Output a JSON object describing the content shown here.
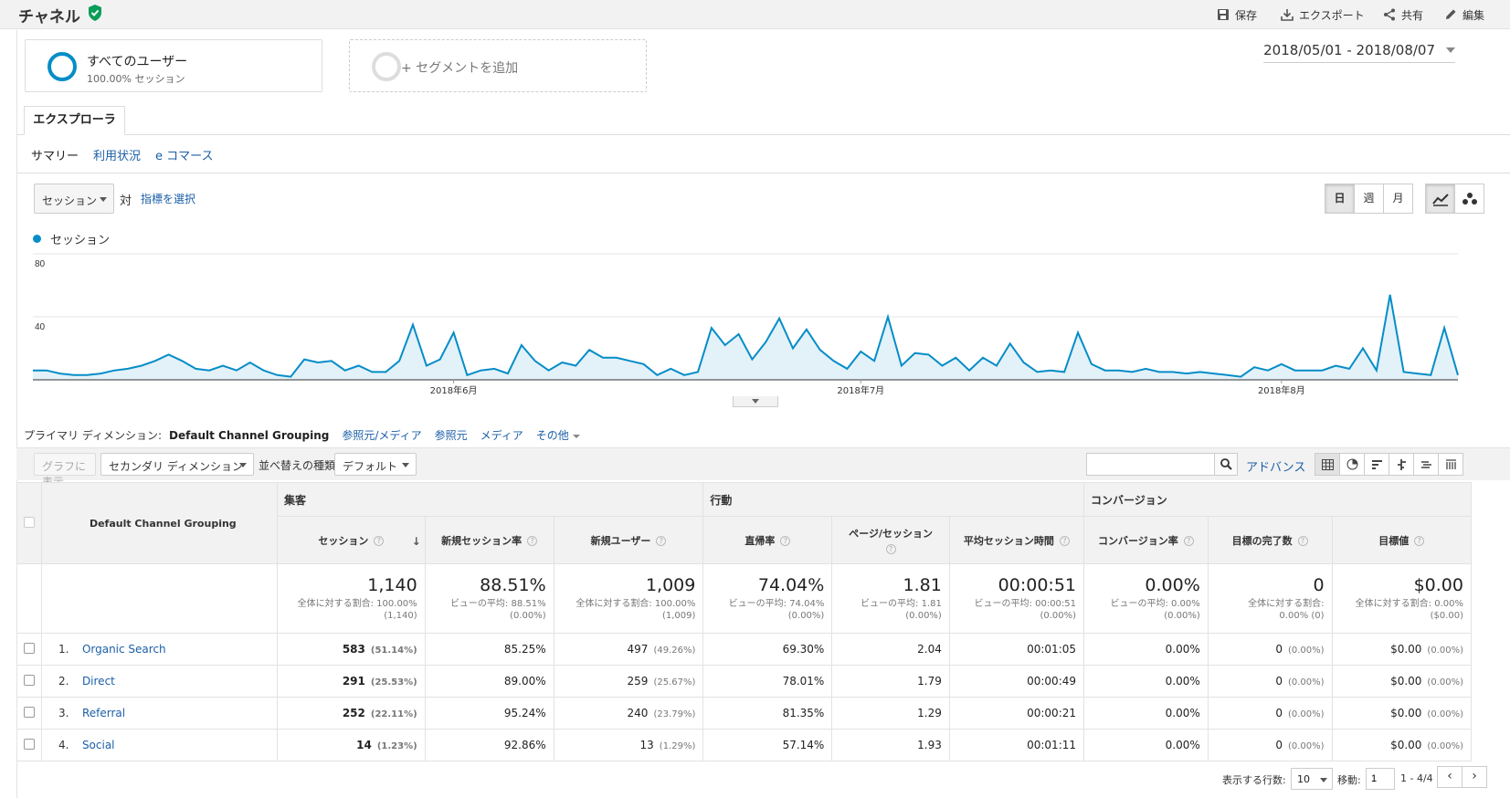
{
  "header": {
    "title": "チャネル",
    "actions": [
      {
        "label": "保存",
        "icon": "save-icon"
      },
      {
        "label": "エクスポート",
        "icon": "export-icon"
      },
      {
        "label": "共有",
        "icon": "share-icon"
      },
      {
        "label": "編集",
        "icon": "edit-icon"
      }
    ]
  },
  "segments": {
    "all": {
      "name": "すべてのユーザー",
      "sub": "100.00% セッション"
    },
    "add": {
      "name": "+ セグメントを追加"
    }
  },
  "date_range": "2018/05/01 - 2018/08/07",
  "tabs": {
    "explorer": "エクスプローラ"
  },
  "subtabs": [
    "サマリー",
    "利用状況",
    "e コマース"
  ],
  "chart_controls": {
    "metric": "セッション",
    "vs": "対",
    "choose_metric": "指標を選択",
    "periods": [
      "日",
      "週",
      "月"
    ],
    "active_period": "日"
  },
  "chart_data": {
    "type": "area",
    "series": [
      {
        "name": "セッション",
        "color": "#058dc7",
        "values": [
          6,
          6,
          4,
          3,
          3,
          4,
          6,
          7,
          9,
          12,
          16,
          12,
          7,
          6,
          9,
          6,
          11,
          6,
          3,
          2,
          13,
          11,
          12,
          6,
          9,
          5,
          5,
          12,
          35,
          9,
          13,
          30,
          3,
          6,
          7,
          4,
          22,
          12,
          6,
          11,
          9,
          19,
          14,
          14,
          12,
          10,
          3,
          7,
          3,
          5,
          33,
          22,
          29,
          13,
          24,
          39,
          20,
          32,
          19,
          12,
          7,
          18,
          12,
          40,
          9,
          17,
          16,
          9,
          14,
          6,
          14,
          9,
          23,
          11,
          5,
          6,
          5,
          30,
          10,
          6,
          6,
          5,
          7,
          5,
          5,
          4,
          5,
          4,
          3,
          2,
          8,
          6,
          10,
          6,
          6,
          6,
          9,
          7,
          20,
          6,
          54,
          5,
          4,
          3,
          33,
          3
        ]
      }
    ],
    "x_labels": [
      "2018年6月",
      "2018年7月",
      "2018年8月"
    ],
    "y_ticks": [
      40,
      80
    ],
    "ylim": [
      0,
      80
    ]
  },
  "dimension_bar": {
    "label": "プライマリ ディメンション:",
    "options": [
      "Default Channel Grouping",
      "参照元/メディア",
      "参照元",
      "メディア",
      "その他"
    ]
  },
  "toolbar": {
    "plot": "グラフに表示",
    "secondary": "セカンダリ ディメンション",
    "sort_label": "並べ替えの種類:",
    "sort_value": "デフォルト",
    "search_placeholder": "",
    "advanced": "アドバンス"
  },
  "table": {
    "dimension_header": "Default Channel Grouping",
    "groups": [
      "集客",
      "行動",
      "コンバージョン"
    ],
    "columns": [
      "セッション",
      "新規セッション率",
      "新規ユーザー",
      "直帰率",
      "ページ/セッション",
      "平均セッション時間",
      "コンバージョン率",
      "目標の完了数",
      "目標値"
    ],
    "totals": [
      {
        "main": "1,140",
        "sub1": "全体に対する割合: 100.00%",
        "sub2": "(1,140)"
      },
      {
        "main": "88.51%",
        "sub1": "ビューの平均: 88.51%",
        "sub2": "(0.00%)"
      },
      {
        "main": "1,009",
        "sub1": "全体に対する割合: 100.00%",
        "sub2": "(1,009)"
      },
      {
        "main": "74.04%",
        "sub1": "ビューの平均: 74.04%",
        "sub2": "(0.00%)"
      },
      {
        "main": "1.81",
        "sub1": "ビューの平均: 1.81",
        "sub2": "(0.00%)"
      },
      {
        "main": "00:00:51",
        "sub1": "ビューの平均: 00:00:51",
        "sub2": "(0.00%)"
      },
      {
        "main": "0.00%",
        "sub1": "ビューの平均: 0.00%",
        "sub2": "(0.00%)"
      },
      {
        "main": "0",
        "sub1": "全体に対する割合:",
        "sub2": "0.00% (0)"
      },
      {
        "main": "$0.00",
        "sub1": "全体に対する割合: 0.00%",
        "sub2": "($0.00)"
      }
    ],
    "rows": [
      {
        "idx": "1.",
        "name": "Organic Search",
        "sessions": "583",
        "sessions_pct": "(51.14%)",
        "new_rate": "85.25%",
        "new_users": "497",
        "new_users_pct": "(49.26%)",
        "bounce": "69.30%",
        "pages": "2.04",
        "duration": "00:01:05",
        "conv": "0.00%",
        "goals": "0",
        "goals_pct": "(0.00%)",
        "value": "$0.00",
        "value_pct": "(0.00%)"
      },
      {
        "idx": "2.",
        "name": "Direct",
        "sessions": "291",
        "sessions_pct": "(25.53%)",
        "new_rate": "89.00%",
        "new_users": "259",
        "new_users_pct": "(25.67%)",
        "bounce": "78.01%",
        "pages": "1.79",
        "duration": "00:00:49",
        "conv": "0.00%",
        "goals": "0",
        "goals_pct": "(0.00%)",
        "value": "$0.00",
        "value_pct": "(0.00%)"
      },
      {
        "idx": "3.",
        "name": "Referral",
        "sessions": "252",
        "sessions_pct": "(22.11%)",
        "new_rate": "95.24%",
        "new_users": "240",
        "new_users_pct": "(23.79%)",
        "bounce": "81.35%",
        "pages": "1.29",
        "duration": "00:00:21",
        "conv": "0.00%",
        "goals": "0",
        "goals_pct": "(0.00%)",
        "value": "$0.00",
        "value_pct": "(0.00%)"
      },
      {
        "idx": "4.",
        "name": "Social",
        "sessions": "14",
        "sessions_pct": "(1.23%)",
        "new_rate": "92.86%",
        "new_users": "13",
        "new_users_pct": "(1.29%)",
        "bounce": "57.14%",
        "pages": "1.93",
        "duration": "00:01:11",
        "conv": "0.00%",
        "goals": "0",
        "goals_pct": "(0.00%)",
        "value": "$0.00",
        "value_pct": "(0.00%)"
      }
    ]
  },
  "footer": {
    "rows_label": "表示する行数:",
    "rows_value": "10",
    "goto_label": "移動:",
    "goto_value": "1",
    "range": "1 - 4/4",
    "prev": "‹",
    "next": "›"
  }
}
